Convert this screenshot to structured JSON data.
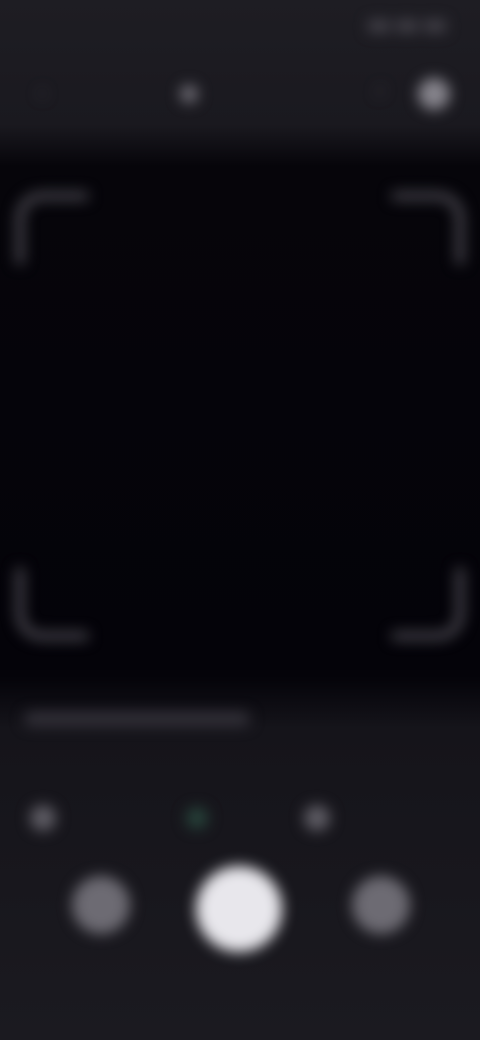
{
  "status_bar": {
    "time": "",
    "tray_icons": [
      "signal-icon",
      "wifi-icon",
      "battery-icon"
    ]
  },
  "header": {
    "back_icon": "back-arrow-icon",
    "title": "",
    "title_icon": "scan-icon",
    "flash_icon": "flash-icon",
    "settings_icon": "settings-icon"
  },
  "viewfinder": {
    "hint": ""
  },
  "modes": {
    "items": [
      {
        "label": "",
        "icon": "mode-left-icon"
      },
      {
        "label": "",
        "icon": "mode-center-icon"
      },
      {
        "label": "",
        "icon": "mode-right-icon"
      }
    ]
  },
  "controls": {
    "gallery_label": "",
    "switch_label": ""
  },
  "colors": {
    "background": "#1b1a20",
    "viewfinder": "#040309",
    "shutter": "#e8e7ec",
    "corner": "#4a4850",
    "active_mode": "#27423a"
  }
}
